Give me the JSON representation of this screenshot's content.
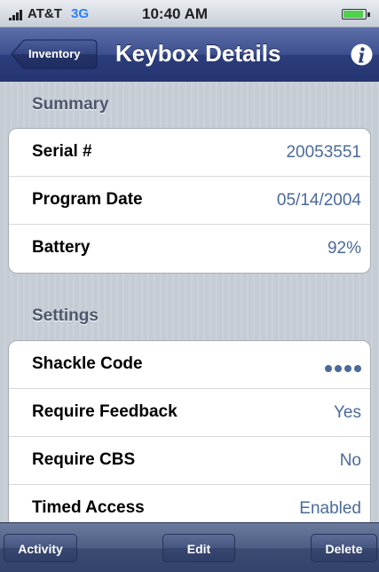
{
  "status_bar": {
    "carrier": "AT&T",
    "network": "3G",
    "time": "10:40 AM"
  },
  "nav": {
    "back_label": "Inventory",
    "title": "Keybox Details",
    "info_icon": "info-icon"
  },
  "sections": {
    "summary": {
      "header": "Summary",
      "rows": [
        {
          "label": "Serial #",
          "value": "20053551"
        },
        {
          "label": "Program Date",
          "value": "05/14/2004"
        },
        {
          "label": "Battery",
          "value": "92%"
        }
      ]
    },
    "settings": {
      "header": "Settings",
      "rows": [
        {
          "label": "Shackle Code",
          "value": ""
        },
        {
          "label": "Require Feedback",
          "value": "Yes"
        },
        {
          "label": "Require CBS",
          "value": "No"
        },
        {
          "label": "Timed Access",
          "value": "Enabled"
        }
      ]
    }
  },
  "toolbar": {
    "activity_label": "Activity",
    "edit_label": "Edit",
    "delete_label": "Delete"
  },
  "colors": {
    "nav_blue": "#2c3d7b",
    "value_blue": "#4a6a9c",
    "battery_green": "#4fd14a"
  }
}
